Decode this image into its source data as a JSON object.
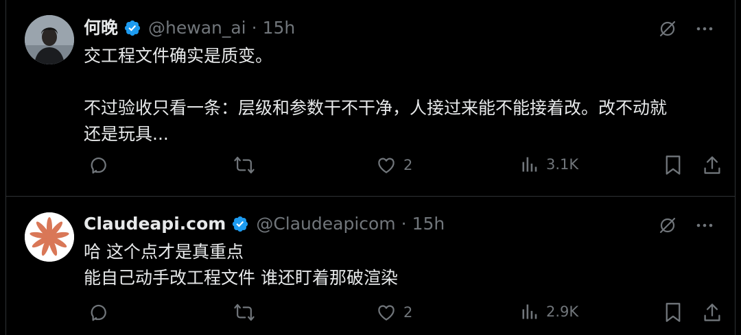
{
  "colors": {
    "background": "#000000",
    "text_primary": "#e7e9ea",
    "text_secondary": "#71767b",
    "divider": "#2f3336",
    "verified_blue": "#1d9bf0",
    "logo_orange": "#d97757"
  },
  "tweets": [
    {
      "avatar_icon": "user-photo-avatar",
      "name": "何晚",
      "handle": "@hewan_ai",
      "separator": "·",
      "time": "15h",
      "body_lines": [
        "交工程文件确实是质变。",
        "",
        "不过验收只看一条：层级和参数干不干净，人接过来能不能接着改。改不动就",
        "还是玩具..."
      ],
      "likes": "2",
      "views": "3.1K"
    },
    {
      "avatar_icon": "claude-logo-avatar",
      "name": "Claudeapi.com",
      "handle": "@Claudeapicom",
      "separator": "·",
      "time": "15h",
      "body_lines": [
        "哈 这个点才是真重点",
        "能自己动手改工程文件 谁还盯着那破渲染"
      ],
      "likes": "2",
      "views": "2.9K"
    }
  ]
}
